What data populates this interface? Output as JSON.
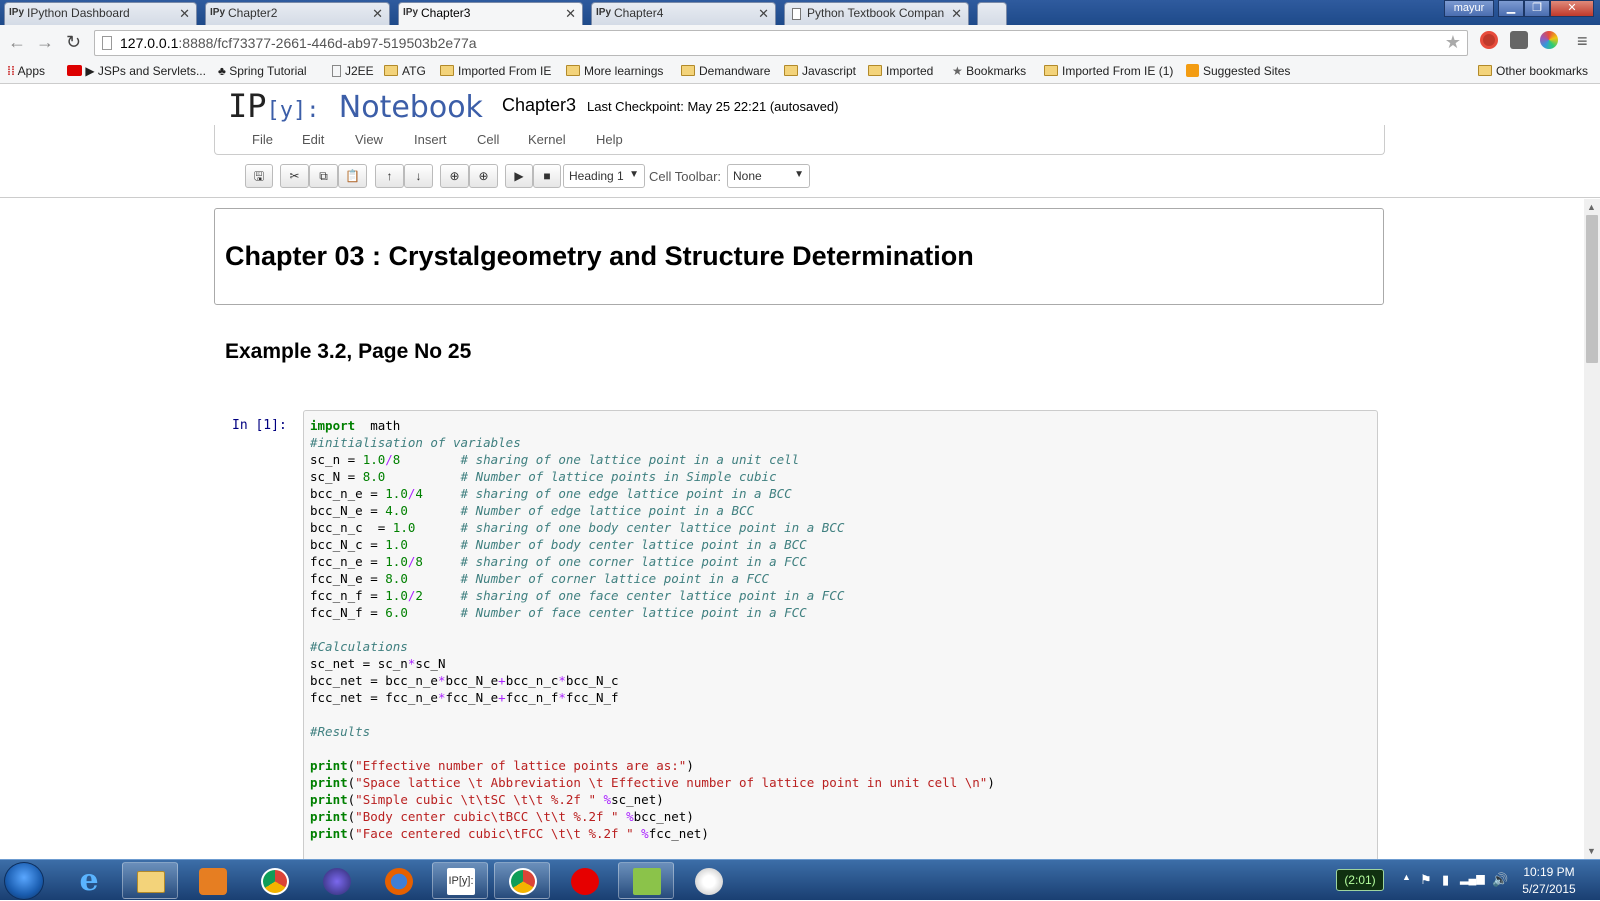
{
  "browser": {
    "tabs": [
      {
        "favicon": "IPy",
        "label": "IPython Dashboard"
      },
      {
        "favicon": "IPy",
        "label": "Chapter2"
      },
      {
        "favicon": "IPy",
        "label": "Chapter3"
      },
      {
        "favicon": "IPy",
        "label": "Chapter4"
      },
      {
        "favicon": "",
        "label": "Python Textbook Compan"
      }
    ],
    "user": "mayur",
    "url_host": "127.0.0.1",
    "url_path": ":8888/fcf73377-2661-446d-ab97-519503b2e77a",
    "bookmarks": [
      "Apps",
      "JSPs and Servlets...",
      "Spring Tutorial",
      "J2EE",
      "ATG",
      "Imported From IE",
      "More learnings",
      "Demandware",
      "Javascript",
      "Imported",
      "Bookmarks",
      "Imported From IE (1)",
      "Suggested Sites",
      "Other bookmarks"
    ]
  },
  "notebook": {
    "logo_ip": "IP",
    "logo_y": "[y]:",
    "logo_nb": "Notebook",
    "name": "Chapter3",
    "checkpoint": "Last Checkpoint: May 25 22:21 (autosaved)",
    "menu": [
      "File",
      "Edit",
      "View",
      "Insert",
      "Cell",
      "Kernel",
      "Help"
    ],
    "toolbar": {
      "cell_type": "Heading 1",
      "cell_toolbar_label": "Cell Toolbar:",
      "cell_toolbar_value": "None"
    },
    "heading1": "Chapter 03 : Crystalgeometry and Structure Determination",
    "heading2": "Example 3.2, Page No 25",
    "prompt": "In [1]:",
    "code": [
      [
        [
          "kw",
          "import"
        ],
        [
          "",
          "  math"
        ]
      ],
      [
        [
          "cm",
          "#initialisation of variables"
        ]
      ],
      [
        [
          "",
          "sc_n = "
        ],
        [
          "num",
          "1.0"
        ],
        [
          "op",
          "/"
        ],
        [
          "num",
          "8"
        ],
        [
          "",
          "        "
        ],
        [
          "cm",
          "# sharing of one lattice point in a unit cell"
        ]
      ],
      [
        [
          "",
          "sc_N = "
        ],
        [
          "num",
          "8.0"
        ],
        [
          "",
          "          "
        ],
        [
          "cm",
          "# Number of lattice points in Simple cubic"
        ]
      ],
      [
        [
          "",
          "bcc_n_e = "
        ],
        [
          "num",
          "1.0"
        ],
        [
          "op",
          "/"
        ],
        [
          "num",
          "4"
        ],
        [
          "",
          "     "
        ],
        [
          "cm",
          "# sharing of one edge lattice point in a BCC"
        ]
      ],
      [
        [
          "",
          "bcc_N_e = "
        ],
        [
          "num",
          "4.0"
        ],
        [
          "",
          "       "
        ],
        [
          "cm",
          "# Number of edge lattice point in a BCC"
        ]
      ],
      [
        [
          "",
          "bcc_n_c  = "
        ],
        [
          "num",
          "1.0"
        ],
        [
          "",
          "      "
        ],
        [
          "cm",
          "# sharing of one body center lattice point in a BCC"
        ]
      ],
      [
        [
          "",
          "bcc_N_c = "
        ],
        [
          "num",
          "1.0"
        ],
        [
          "",
          "       "
        ],
        [
          "cm",
          "# Number of body center lattice point in a BCC"
        ]
      ],
      [
        [
          "",
          "fcc_n_e = "
        ],
        [
          "num",
          "1.0"
        ],
        [
          "op",
          "/"
        ],
        [
          "num",
          "8"
        ],
        [
          "",
          "     "
        ],
        [
          "cm",
          "# sharing of one corner lattice point in a FCC"
        ]
      ],
      [
        [
          "",
          "fcc_N_e = "
        ],
        [
          "num",
          "8.0"
        ],
        [
          "",
          "       "
        ],
        [
          "cm",
          "# Number of corner lattice point in a FCC"
        ]
      ],
      [
        [
          "",
          "fcc_n_f = "
        ],
        [
          "num",
          "1.0"
        ],
        [
          "op",
          "/"
        ],
        [
          "num",
          "2"
        ],
        [
          "",
          "     "
        ],
        [
          "cm",
          "# sharing of one face center lattice point in a FCC"
        ]
      ],
      [
        [
          "",
          "fcc_N_f = "
        ],
        [
          "num",
          "6.0"
        ],
        [
          "",
          "       "
        ],
        [
          "cm",
          "# Number of face center lattice point in a FCC"
        ]
      ],
      [
        [
          "",
          ""
        ]
      ],
      [
        [
          "cm",
          "#Calculations"
        ]
      ],
      [
        [
          "",
          "sc_net = sc_n"
        ],
        [
          "op",
          "*"
        ],
        [
          "",
          "sc_N"
        ]
      ],
      [
        [
          "",
          "bcc_net = bcc_n_e"
        ],
        [
          "op",
          "*"
        ],
        [
          "",
          "bcc_N_e"
        ],
        [
          "op",
          "+"
        ],
        [
          "",
          "bcc_n_c"
        ],
        [
          "op",
          "*"
        ],
        [
          "",
          "bcc_N_c"
        ]
      ],
      [
        [
          "",
          "fcc_net = fcc_n_e"
        ],
        [
          "op",
          "*"
        ],
        [
          "",
          "fcc_N_e"
        ],
        [
          "op",
          "+"
        ],
        [
          "",
          "fcc_n_f"
        ],
        [
          "op",
          "*"
        ],
        [
          "",
          "fcc_N_f"
        ]
      ],
      [
        [
          "",
          ""
        ]
      ],
      [
        [
          "cm",
          "#Results"
        ]
      ],
      [
        [
          "",
          ""
        ]
      ],
      [
        [
          "kw",
          "print"
        ],
        [
          "",
          "("
        ],
        [
          "str",
          "\"Effective number of lattice points are as:\""
        ],
        [
          "",
          ")"
        ]
      ],
      [
        [
          "kw",
          "print"
        ],
        [
          "",
          "("
        ],
        [
          "str",
          "\"Space lattice \\t Abbreviation \\t Effective number of lattice point in unit cell \\n\""
        ],
        [
          "",
          ")"
        ]
      ],
      [
        [
          "kw",
          "print"
        ],
        [
          "",
          "("
        ],
        [
          "str",
          "\"Simple cubic \\t\\tSC \\t\\t %.2f \""
        ],
        [
          "",
          ""
        ],
        [
          "op",
          " %"
        ],
        [
          "",
          "sc_net)"
        ]
      ],
      [
        [
          "kw",
          "print"
        ],
        [
          "",
          "("
        ],
        [
          "str",
          "\"Body center cubic\\tBCC \\t\\t %.2f \""
        ],
        [
          "op",
          " %"
        ],
        [
          "",
          "bcc_net)"
        ]
      ],
      [
        [
          "kw",
          "print"
        ],
        [
          "",
          "("
        ],
        [
          "str",
          "\"Face centered cubic\\tFCC \\t\\t %.2f \""
        ],
        [
          "op",
          " %"
        ],
        [
          "",
          "fcc_net)"
        ]
      ]
    ]
  },
  "taskbar": {
    "battery": "(2:01)",
    "time": "10:19 PM",
    "date": "5/27/2015"
  },
  "colors": {
    "keyword": "#008000",
    "comment": "#408080",
    "string": "#ba2121",
    "operator": "#aa22ff",
    "prompt": "#000080"
  }
}
